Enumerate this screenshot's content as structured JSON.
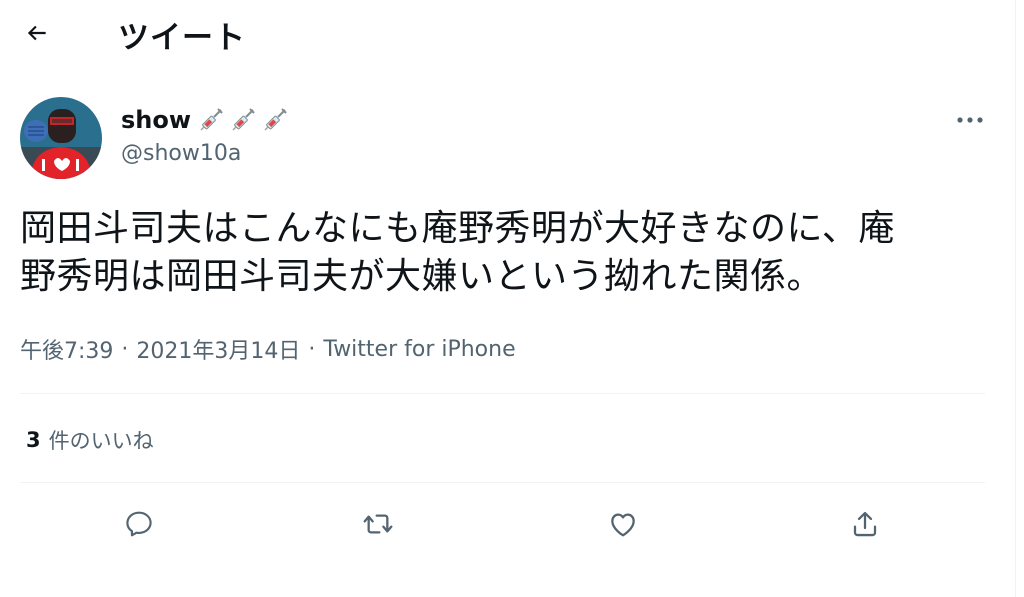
{
  "colors": {
    "text": "#0f1419",
    "secondary": "#536471",
    "divider": "#eff3f4",
    "avatar_bg": "#2b6f8f",
    "avatar_shirt": "#e2232a"
  },
  "header": {
    "title": "ツイート",
    "back_icon": "arrow-left-icon"
  },
  "author": {
    "display_name": "show",
    "name_emojis": [
      "syringe-icon",
      "syringe-icon",
      "syringe-icon"
    ],
    "handle": "@show10a",
    "avatar_icon": "avatar-photo"
  },
  "tweet": {
    "text": "岡田斗司夫はこんなにも庵野秀明が大好きなのに、庵\n野秀明は岡田斗司夫が大嫌いという拗れた関係。"
  },
  "meta": {
    "time": "午後7:39",
    "date": "2021年3月14日",
    "source": "Twitter for iPhone",
    "separator": "·"
  },
  "stats": {
    "likes_count": "3",
    "likes_label": "件のいいね"
  },
  "actions": {
    "items": [
      "reply-icon",
      "retweet-icon",
      "like-icon",
      "share-icon"
    ]
  }
}
